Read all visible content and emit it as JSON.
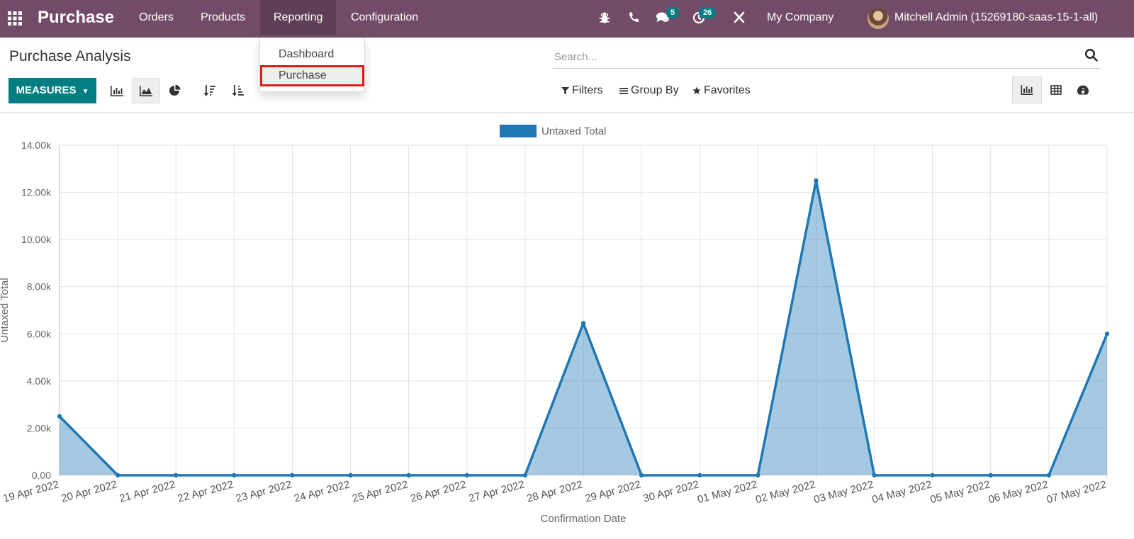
{
  "app": {
    "title": "Purchase"
  },
  "nav": {
    "items": [
      {
        "label": "Orders"
      },
      {
        "label": "Products"
      },
      {
        "label": "Reporting"
      },
      {
        "label": "Configuration"
      }
    ]
  },
  "systray": {
    "messages_count": "5",
    "activities_count": "26",
    "company": "My Company",
    "user": "Mitchell Admin (15269180-saas-15-1-all)"
  },
  "reporting_menu": {
    "items": [
      {
        "label": "Dashboard"
      },
      {
        "label": "Purchase"
      }
    ]
  },
  "page": {
    "title": "Purchase Analysis"
  },
  "search": {
    "placeholder": "Search..."
  },
  "toolbar": {
    "measures_label": "MEASURES",
    "filters_label": "Filters",
    "groupby_label": "Group By",
    "favorites_label": "Favorites"
  },
  "colors": {
    "brand": "#714b67",
    "accent": "#017e84",
    "series": "#1f77b4",
    "highlight": "#e21b1b"
  },
  "chart_data": {
    "type": "area",
    "title": "",
    "xlabel": "Confirmation Date",
    "ylabel": "Untaxed Total",
    "ylim": [
      0,
      14000
    ],
    "y_ticks": [
      "0.00",
      "2.00k",
      "4.00k",
      "6.00k",
      "8.00k",
      "10.00k",
      "12.00k",
      "14.00k"
    ],
    "grid": true,
    "legend_position": "top-center",
    "categories": [
      "19 Apr 2022",
      "20 Apr 2022",
      "21 Apr 2022",
      "22 Apr 2022",
      "23 Apr 2022",
      "24 Apr 2022",
      "25 Apr 2022",
      "26 Apr 2022",
      "27 Apr 2022",
      "28 Apr 2022",
      "29 Apr 2022",
      "30 Apr 2022",
      "01 May 2022",
      "02 May 2022",
      "03 May 2022",
      "04 May 2022",
      "05 May 2022",
      "06 May 2022",
      "07 May 2022"
    ],
    "series": [
      {
        "name": "Untaxed Total",
        "values": [
          2500,
          0,
          0,
          0,
          0,
          0,
          0,
          0,
          0,
          6450,
          0,
          0,
          0,
          12500,
          0,
          0,
          0,
          0,
          6000
        ]
      }
    ]
  }
}
